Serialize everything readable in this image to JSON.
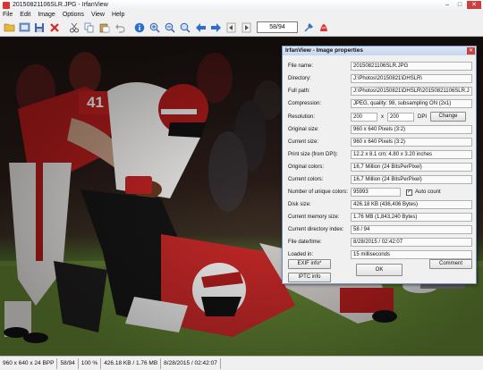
{
  "window": {
    "title": "20150821106SLR.JPG - IrfanView",
    "minimize": "–",
    "maximize": "□",
    "close": "✕"
  },
  "menu": [
    "File",
    "Edit",
    "Image",
    "Options",
    "View",
    "Help"
  ],
  "toolbar": {
    "page_counter": "58/94"
  },
  "statusbar": {
    "dims": "960 x 640 x 24 BPP",
    "index": "58/94",
    "zoom": "100 %",
    "size": "426.18 KB / 1.76 MB",
    "datetime": "8/28/2015 / 02:42:07"
  },
  "dialog": {
    "title": "IrfanView - Image properties",
    "close": "✕",
    "file_name_label": "File name:",
    "file_name": "20150821106SLR.JPG",
    "directory_label": "Directory:",
    "directory": "J:\\Photos\\20150821\\DHSLR\\",
    "full_path_label": "Full path:",
    "full_path": "J:\\Photos\\20150821\\DHSLR\\20150821106SLR.J",
    "compression_label": "Compression:",
    "compression": "JPEG, quality: 98, subsampling ON (2x1)",
    "resolution_label": "Resolution:",
    "res_x": "200",
    "res_sep": "x",
    "res_y": "200",
    "dpi": "DPI",
    "change": "Change",
    "original_size_label": "Original size:",
    "original_size": "960 x 640  Pixels (3:2)",
    "current_size_label": "Current size:",
    "current_size": "960 x 640  Pixels (3:2)",
    "print_size_label": "Print size (from DPI):",
    "print_size": "12.2 x 8.1 cm; 4.80 x 3.20 inches",
    "original_colors_label": "Original colors:",
    "original_colors": "16,7 Million   (24 BitsPerPixel)",
    "current_colors_label": "Current colors:",
    "current_colors": "16,7 Million   (24 BitsPerPixel)",
    "unique_colors_label": "Number of unique colors:",
    "unique_colors": "95993",
    "auto_count": "Auto count",
    "disk_size_label": "Disk size:",
    "disk_size": "426.18 KB (436,406 Bytes)",
    "memory_size_label": "Current memory size:",
    "memory_size": "1.76  MB (1,843,240 Bytes)",
    "dir_index_label": "Current directory index:",
    "dir_index": "58  /  94",
    "file_date_label": "File date/time:",
    "file_date": "8/28/2015 / 02:42:07",
    "loaded_in_label": "Loaded in:",
    "loaded_in": "15 milliseconds",
    "exif_button": "EXIF info*",
    "ok_button": "OK",
    "comment_button": "Comment",
    "iptc_button": "IPTC info"
  }
}
